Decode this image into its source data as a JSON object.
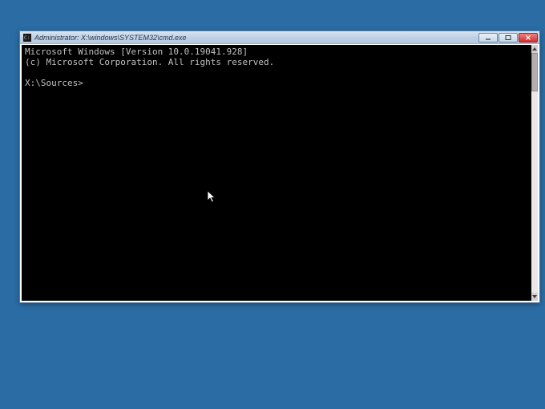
{
  "window": {
    "title": "Administrator: X:\\windows\\SYSTEM32\\cmd.exe"
  },
  "console": {
    "line1": "Microsoft Windows [Version 10.0.19041.928]",
    "line2": "(c) Microsoft Corporation. All rights reserved.",
    "prompt": "X:\\Sources>"
  }
}
